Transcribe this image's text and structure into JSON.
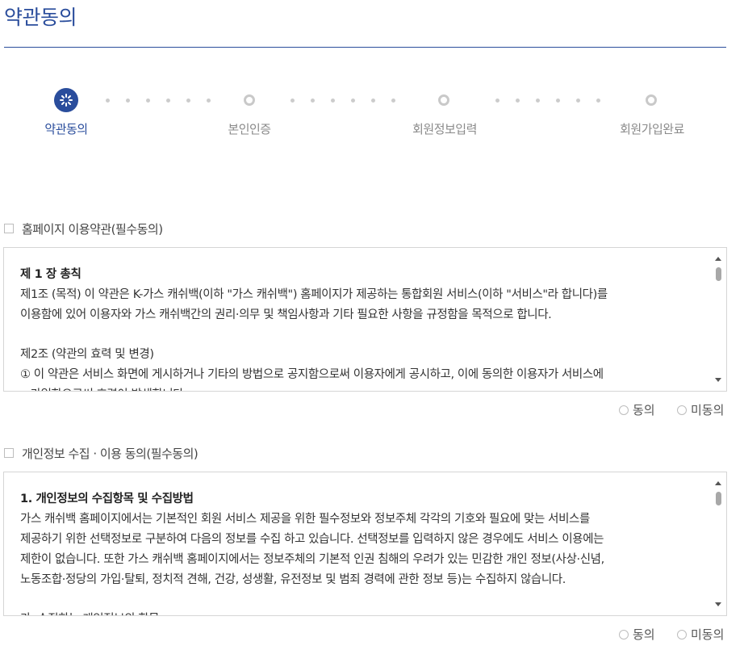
{
  "page": {
    "title": "약관동의"
  },
  "stepper": {
    "steps": [
      {
        "label": "약관동의",
        "active": true
      },
      {
        "label": "본인인증",
        "active": false
      },
      {
        "label": "회원정보입력",
        "active": false
      },
      {
        "label": "회원가입완료",
        "active": false
      }
    ]
  },
  "terms": {
    "title": "홈페이지 이용약관(필수동의)",
    "heading": "제 1 장 총칙",
    "lines": [
      "제1조 (목적) 이 약관은 K-가스 캐쉬백(이하 \"가스 캐쉬백\") 홈페이지가 제공하는 통합회원 서비스(이하 \"서비스\"라 합니다)를",
      "이용함에 있어 이용자와 가스 캐쉬백간의 권리·의무 및 책임사항과 기타 필요한 사항을 규정함을 목적으로 합니다.",
      "",
      "제2조 (약관의 효력 및 변경)",
      "① 이 약관은 서비스 화면에 게시하거나 기타의 방법으로 공지함으로써 이용자에게 공시하고, 이에 동의한 이용자가 서비스에",
      "   가입함으로써 효력이 발생합니다."
    ],
    "agree_label": "동의",
    "disagree_label": "미동의"
  },
  "privacy": {
    "title": "개인정보 수집 · 이용 동의(필수동의)",
    "heading": "1. 개인정보의 수집항목 및 수집방법",
    "lines": [
      "가스 캐쉬백 홈페이지에서는 기본적인 회원 서비스 제공을 위한 필수정보와 정보주체 각각의 기호와 필요에 맞는 서비스를",
      "제공하기 위한 선택정보로 구분하여 다음의 정보를 수집 하고 있습니다. 선택정보를 입력하지 않은 경우에도 서비스 이용에는",
      "제한이 없습니다. 또한 가스 캐쉬백 홈페이지에서는 정보주체의 기본적 인권 침해의 우려가 있는 민감한 개인 정보(사상·신념,",
      "노동조합·정당의 가입·탈퇴, 정치적 견해, 건강, 성생활, 유전정보 및 범죄 경력에 관한 정보 등)는 수집하지 않습니다.",
      "",
      "가. 수집하는 개인정보의 항목"
    ],
    "agree_label": "동의",
    "disagree_label": "미동의"
  },
  "colors": {
    "accent": "#2a4d9c",
    "inactive": "#c9c9c9"
  },
  "icons": {
    "active_step": "loading-spinner-icon",
    "checkbox": "checkbox-icon",
    "radio": "radio-icon"
  }
}
